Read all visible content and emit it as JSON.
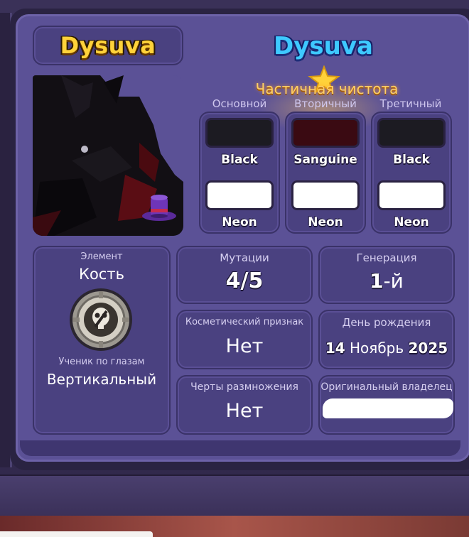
{
  "pet": {
    "name_left": "Dysuva",
    "name_right": "Dysuva",
    "purity_label": "Частичная чистота"
  },
  "colors": {
    "columns": [
      {
        "label": "Основной",
        "top_swatch": "#1c1b22",
        "top_name": "Black",
        "bottom_name": "Neon"
      },
      {
        "label": "Вторичный",
        "top_swatch": "#3a0a12",
        "top_name": "Sanguine",
        "bottom_name": "Neon"
      },
      {
        "label": "Третичный",
        "top_swatch": "#1c1b22",
        "top_name": "Black",
        "bottom_name": "Neon"
      }
    ]
  },
  "element": {
    "label": "Элемент",
    "value": "Кость",
    "icon": "bone-element-gear-icon",
    "eye_label": "Ученик по глазам",
    "eye_value": "Вертикальный"
  },
  "stats": {
    "mutations": {
      "label": "Мутации",
      "value": "4/5"
    },
    "generation": {
      "label": "Генерация",
      "value_num": "1",
      "value_suffix": "-й"
    },
    "cosmetic": {
      "label": "Косметический признак",
      "value": "Нет"
    },
    "birthday": {
      "label": "День рождения",
      "day": "14",
      "month": "Ноябрь",
      "year": "2025"
    },
    "breeding": {
      "label": "Черты размножения",
      "value": "Нет"
    },
    "owner": {
      "label": "Оригинальный владелец"
    }
  },
  "theme": {
    "panel": "#5b5196",
    "tile": "#4a4180",
    "name_left_color": "#ffd23a",
    "name_right_color": "#3ec9ff"
  }
}
